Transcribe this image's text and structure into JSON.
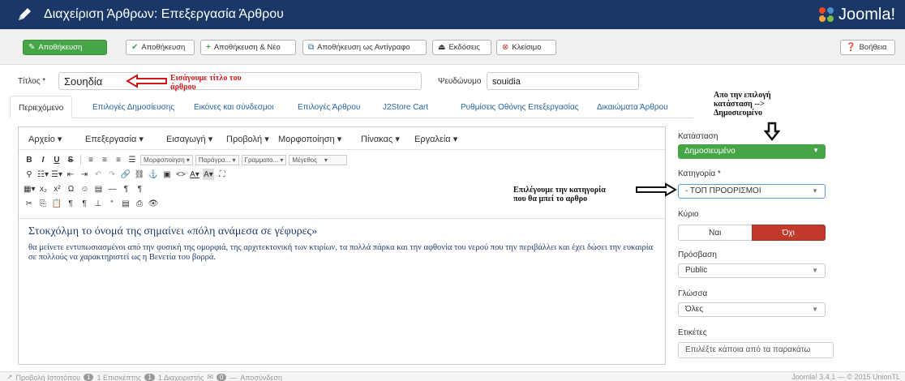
{
  "header": {
    "title": "Διαχείριση Άρθρων: Επεξεργασία Άρθρου",
    "logo_text": "Joomla!"
  },
  "toolbar": {
    "save": "Αποθήκευση",
    "save_close": "Αποθήκευση",
    "save_new": "Αποθήκευση & Νέο",
    "save_copy": "Αποθήκευση ως Αντίγραφο",
    "versions": "Εκδόσεις",
    "close": "Κλείσιμο",
    "help": "Βοήθεια"
  },
  "form": {
    "title_label": "Τίτλος *",
    "title_value": "Σουηδία",
    "alias_label": "Ψευδώνυμο",
    "alias_value": "souidia"
  },
  "annotations": {
    "title_note_1": "Εισάγουμε τίτλο του",
    "title_note_2": "άρθρου",
    "status_note_1": "Απο την επιλογή",
    "status_note_2": "κατάσταση -->",
    "status_note_3": "Δημοσιευμένο",
    "category_note_1": "Επιλέγουμε την κατηγορία",
    "category_note_2": "που θα μπεί το αρθρο"
  },
  "tabs": [
    {
      "label": "Περιεχόμενο"
    },
    {
      "label": "Επιλογές Δημοσίευσης"
    },
    {
      "label": "Εικόνες και σύνδεσμοι"
    },
    {
      "label": "Επιλογές Άρθρου"
    },
    {
      "label": "J2Store Cart"
    },
    {
      "label": "Ρυθμίσεις Οθόνης Επεξεργασίας"
    },
    {
      "label": "Δικαιώματα Άρθρου"
    }
  ],
  "editor": {
    "menu": [
      "Αρχείο",
      "Επεξεργασία",
      "Εισαγωγή",
      "Προβολή",
      "Μορφοποίηση",
      "Πίνακας",
      "Εργαλεία"
    ],
    "format_select": "Μορφοποίηση",
    "paragraph_select": "Παράγρα...",
    "font_select": "Γραμματο...",
    "size_select": "Μέγεθος",
    "heading": "Στοκχόλμη το όνομά της σημαίνει «πόλη ανάμεσα σε γέφυρες»",
    "body": "θα μείνετε εντυπωσιασμένοι από την φυσική της ομορφιά, της αρχιτεκτονική των κτιρίων, τα πολλά πάρκα και την αφθονία του νερού που την περιβάλλει και έχει δώσει την ευκαιρία σε πολλούς να χαρακτηριστεί ως η Βενετία του βορρά."
  },
  "sidebar": {
    "status_label": "Κατάσταση",
    "status_value": "Δημοσιευμένο",
    "category_label": "Κατηγορία *",
    "category_value": "- ΤΟΠ ΠΡΟΟΡΙΣΜΟΙ",
    "featured_label": "Κύριο",
    "featured_yes": "Ναι",
    "featured_no": "Όχι",
    "access_label": "Πρόσβαση",
    "access_value": "Public",
    "language_label": "Γλώσσα",
    "language_value": "Όλες",
    "tags_label": "Ετικέτες",
    "tags_placeholder": "Επιλέξτε κάποια από τα παρακάτω"
  },
  "footer": {
    "view_site": "Προβολή Ιστοτόπου",
    "visitors_count": "1",
    "visitors_label": "1 Επισκέπτης",
    "admins_count": "1",
    "admins_label": "1 Διαχειριστής",
    "messages_count": "0",
    "logout": "Αποσύνδεση",
    "version": "Joomla! 3.4.1 — © 2015 UnionTL"
  },
  "colors": {
    "header_bg": "#1a3867",
    "save_green": "#46a546",
    "annotation_red": "#cc1a1a",
    "no_button_red": "#c0392b",
    "link_blue": "#2565a6"
  }
}
